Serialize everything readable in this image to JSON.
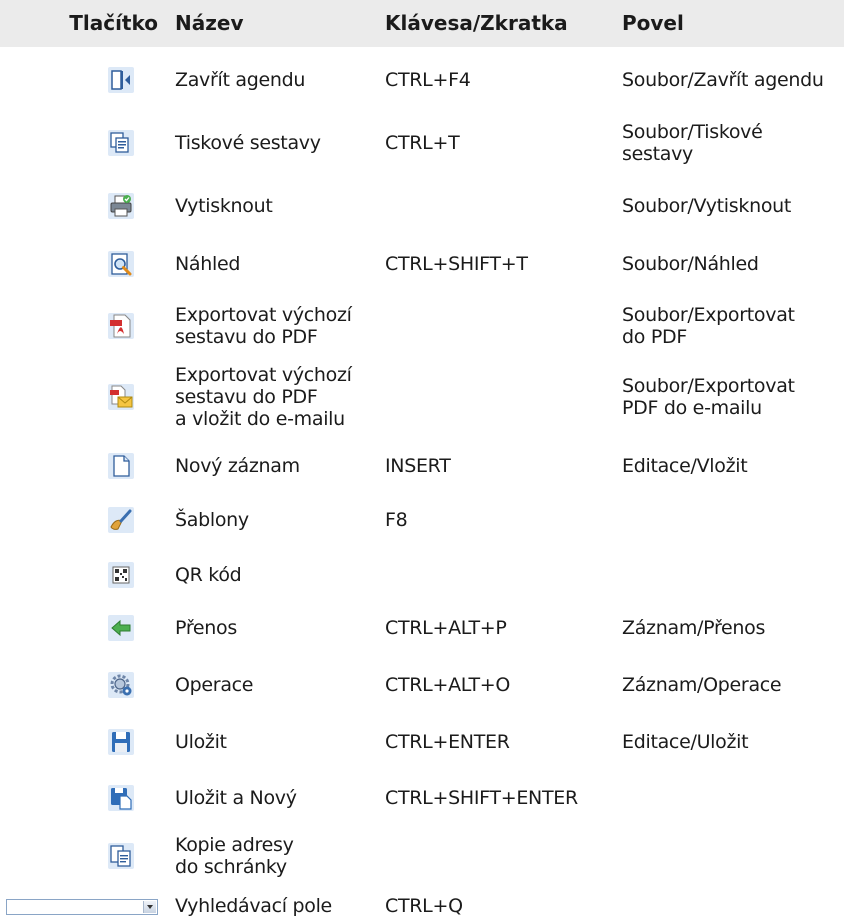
{
  "header": {
    "button": "Tlačítko",
    "name": "Název",
    "key": "Klávesa/Zkratka",
    "command": "Povel"
  },
  "rows": [
    {
      "icon": "close-agenda-icon",
      "name": "Zavřít agendu",
      "key": "CTRL+F4",
      "command": "Soubor/Zavřít agendu"
    },
    {
      "icon": "print-reports-icon",
      "name": "Tiskové sestavy",
      "key": "CTRL+T",
      "command": "Soubor/Tiskové\nsestavy"
    },
    {
      "icon": "printer-icon",
      "name": "Vytisknout",
      "key": "",
      "command": "Soubor/Vytisknout"
    },
    {
      "icon": "preview-icon",
      "name": "Náhled",
      "key": "CTRL+SHIFT+T",
      "command": "Soubor/Náhled"
    },
    {
      "icon": "pdf-export-icon",
      "name": "Exportovat výchozí\nsestavu do PDF",
      "key": "",
      "command": "Soubor/Exportovat\ndo PDF"
    },
    {
      "icon": "pdf-email-icon",
      "name": "Exportovat výchozí\nsestavu do PDF\na vložit do e-mailu",
      "key": "",
      "command": "Soubor/Exportovat\nPDF do e-mailu"
    },
    {
      "icon": "new-record-icon",
      "name": "Nový záznam",
      "key": "INSERT",
      "command": "Editace/Vložit"
    },
    {
      "icon": "templates-brush-icon",
      "name": "Šablony",
      "key": "F8",
      "command": ""
    },
    {
      "icon": "qr-code-icon",
      "name": "QR kód",
      "key": "",
      "command": ""
    },
    {
      "icon": "transfer-arrow-icon",
      "name": "Přenos",
      "key": "CTRL+ALT+P",
      "command": "Záznam/Přenos"
    },
    {
      "icon": "operations-gear-icon",
      "name": "Operace",
      "key": "CTRL+ALT+O",
      "command": "Záznam/Operace"
    },
    {
      "icon": "save-icon",
      "name": "Uložit",
      "key": "CTRL+ENTER",
      "command": "Editace/Uložit"
    },
    {
      "icon": "save-and-new-icon",
      "name": "Uložit a Nový",
      "key": "CTRL+SHIFT+ENTER",
      "command": ""
    },
    {
      "icon": "copy-address-icon",
      "name": "Kopie adresy\ndo schránky",
      "key": "",
      "command": ""
    },
    {
      "icon": "search-field-combobox",
      "name": "Vyhledávací pole",
      "key": "CTRL+Q",
      "command": ""
    }
  ]
}
